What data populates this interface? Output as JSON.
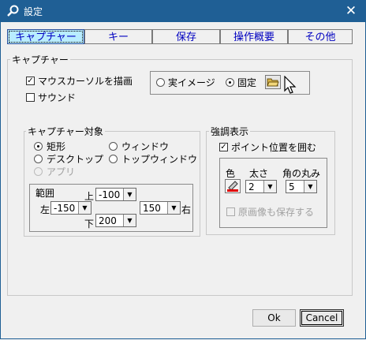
{
  "window": {
    "title": "設定",
    "close_glyph": "✕"
  },
  "tabs": [
    {
      "label": "キャプチャー",
      "active": true
    },
    {
      "label": "キー"
    },
    {
      "label": "保存"
    },
    {
      "label": "操作概要"
    },
    {
      "label": "その他"
    }
  ],
  "capture_group": {
    "label": "キャプチャー",
    "draw_cursor": {
      "label": "マウスカーソルを描画",
      "checked": true
    },
    "sound": {
      "label": "サウンド",
      "checked": false
    },
    "image_mode": {
      "real_image": "実イメージ",
      "fixed": "固定",
      "selected": "fixed"
    }
  },
  "target_group": {
    "label": "キャプチャー対象",
    "options": {
      "rect": "矩形",
      "window": "ウィンドウ",
      "desktop": "デスクトップ",
      "top_window": "トップウィンドウ",
      "app": "アプリ"
    },
    "selected": "rect",
    "range": {
      "label": "範囲",
      "top_label": "上",
      "top": "-100",
      "left_label": "左",
      "left": "-150",
      "right": "150",
      "right_label": "右",
      "bottom_label": "下",
      "bottom": "200"
    }
  },
  "emphasis_group": {
    "label": "強調表示",
    "enclose_pointer": {
      "label": "ポイント位置を囲む",
      "checked": true
    },
    "color_label": "色",
    "thickness_label": "太さ",
    "thickness": "2",
    "corner_label": "角の丸み",
    "corner": "5",
    "save_original": {
      "label": "原画像も保存する",
      "checked": false,
      "disabled": true
    }
  },
  "buttons": {
    "ok": "Ok",
    "cancel": "Cancel"
  }
}
